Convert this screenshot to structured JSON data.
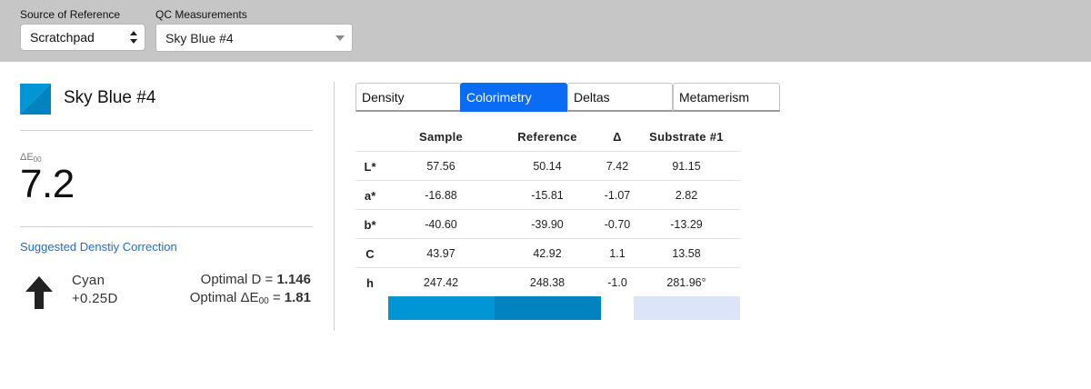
{
  "toolbar": {
    "source_label": "Source of Reference",
    "source_value": "Scratchpad",
    "qc_label": "QC Measurements",
    "qc_value": "Sky Blue #4"
  },
  "swatch": {
    "name": "Sky Blue #4",
    "sample_color": "#0095D4",
    "reference_color": "#0083BE"
  },
  "delta_e": {
    "label": "ΔE",
    "label_sub": "00",
    "value": "7.2"
  },
  "correction": {
    "link": "Suggested Denstiy Correction",
    "channel": "Cyan",
    "amount": "+0.25D",
    "optimal_d_label": "Optimal D = ",
    "optimal_d_value": "1.146",
    "optimal_de_label_a": "Optimal ΔE",
    "optimal_de_sub": "00",
    "optimal_de_label_b": " = ",
    "optimal_de_value": "1.81"
  },
  "tabs": [
    {
      "label": "Density",
      "active": false
    },
    {
      "label": "Colorimetry",
      "active": true
    },
    {
      "label": "Deltas",
      "active": false
    },
    {
      "label": "Metamerism",
      "active": false
    }
  ],
  "table": {
    "headers": [
      "Sample",
      "Reference",
      "Δ",
      "Substrate #1"
    ],
    "rows": [
      {
        "key": "L*",
        "sample": "57.56",
        "reference": "50.14",
        "delta": "7.42",
        "substrate": "91.15"
      },
      {
        "key": "a*",
        "sample": "-16.88",
        "reference": "-15.81",
        "delta": "-1.07",
        "substrate": "2.82"
      },
      {
        "key": "b*",
        "sample": "-40.60",
        "reference": "-39.90",
        "delta": "-0.70",
        "substrate": "-13.29"
      },
      {
        "key": "C",
        "sample": "43.97",
        "reference": "42.92",
        "delta": "1.1",
        "substrate": "13.58"
      },
      {
        "key": "h",
        "sample": "247.42",
        "reference": "248.38",
        "delta": "-1.0",
        "substrate": "281.96°"
      }
    ],
    "swatch_colors": {
      "sample": "#0095D4",
      "reference": "#0083BE",
      "substrate": "#DCE4FA"
    }
  },
  "colors": {
    "accent": "#0A6CF5",
    "link": "#1A6FD6",
    "toolbar_bg": "#C6C6C6"
  }
}
